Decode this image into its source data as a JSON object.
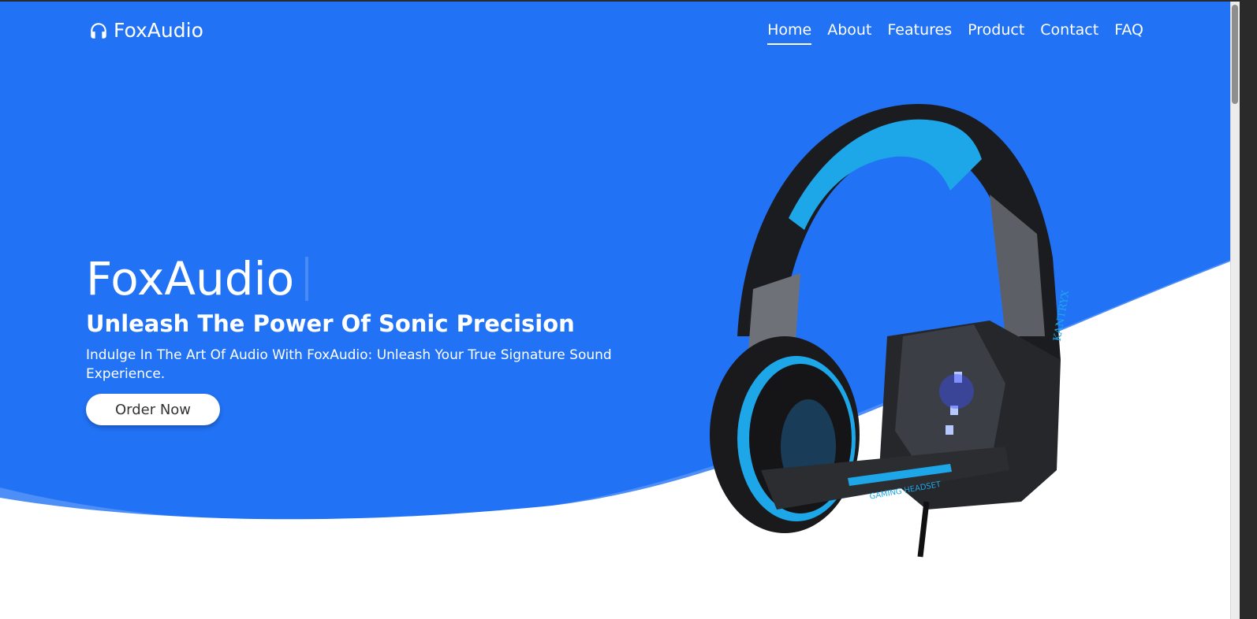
{
  "brand": {
    "name": "FoxAudio",
    "icon": "headphones-icon"
  },
  "nav": {
    "items": [
      {
        "label": "Home",
        "active": true
      },
      {
        "label": "About",
        "active": false
      },
      {
        "label": "Features",
        "active": false
      },
      {
        "label": "Product",
        "active": false
      },
      {
        "label": "Contact",
        "active": false
      },
      {
        "label": "FAQ",
        "active": false
      }
    ]
  },
  "hero": {
    "title": "FoxAudio",
    "subtitle": "Unleash The Power Of Sonic Precision",
    "description": "Indulge In The Art Of Audio With FoxAudio: Unleash Your True Signature Sound Experience.",
    "cta_label": "Order Now",
    "image_text": "GAMING HEADSET",
    "image_brand": "KANTRYX"
  },
  "colors": {
    "primary_blue": "#2272f5",
    "wave_light": "#4d8ef7",
    "headset_accent": "#1ea7e8"
  }
}
